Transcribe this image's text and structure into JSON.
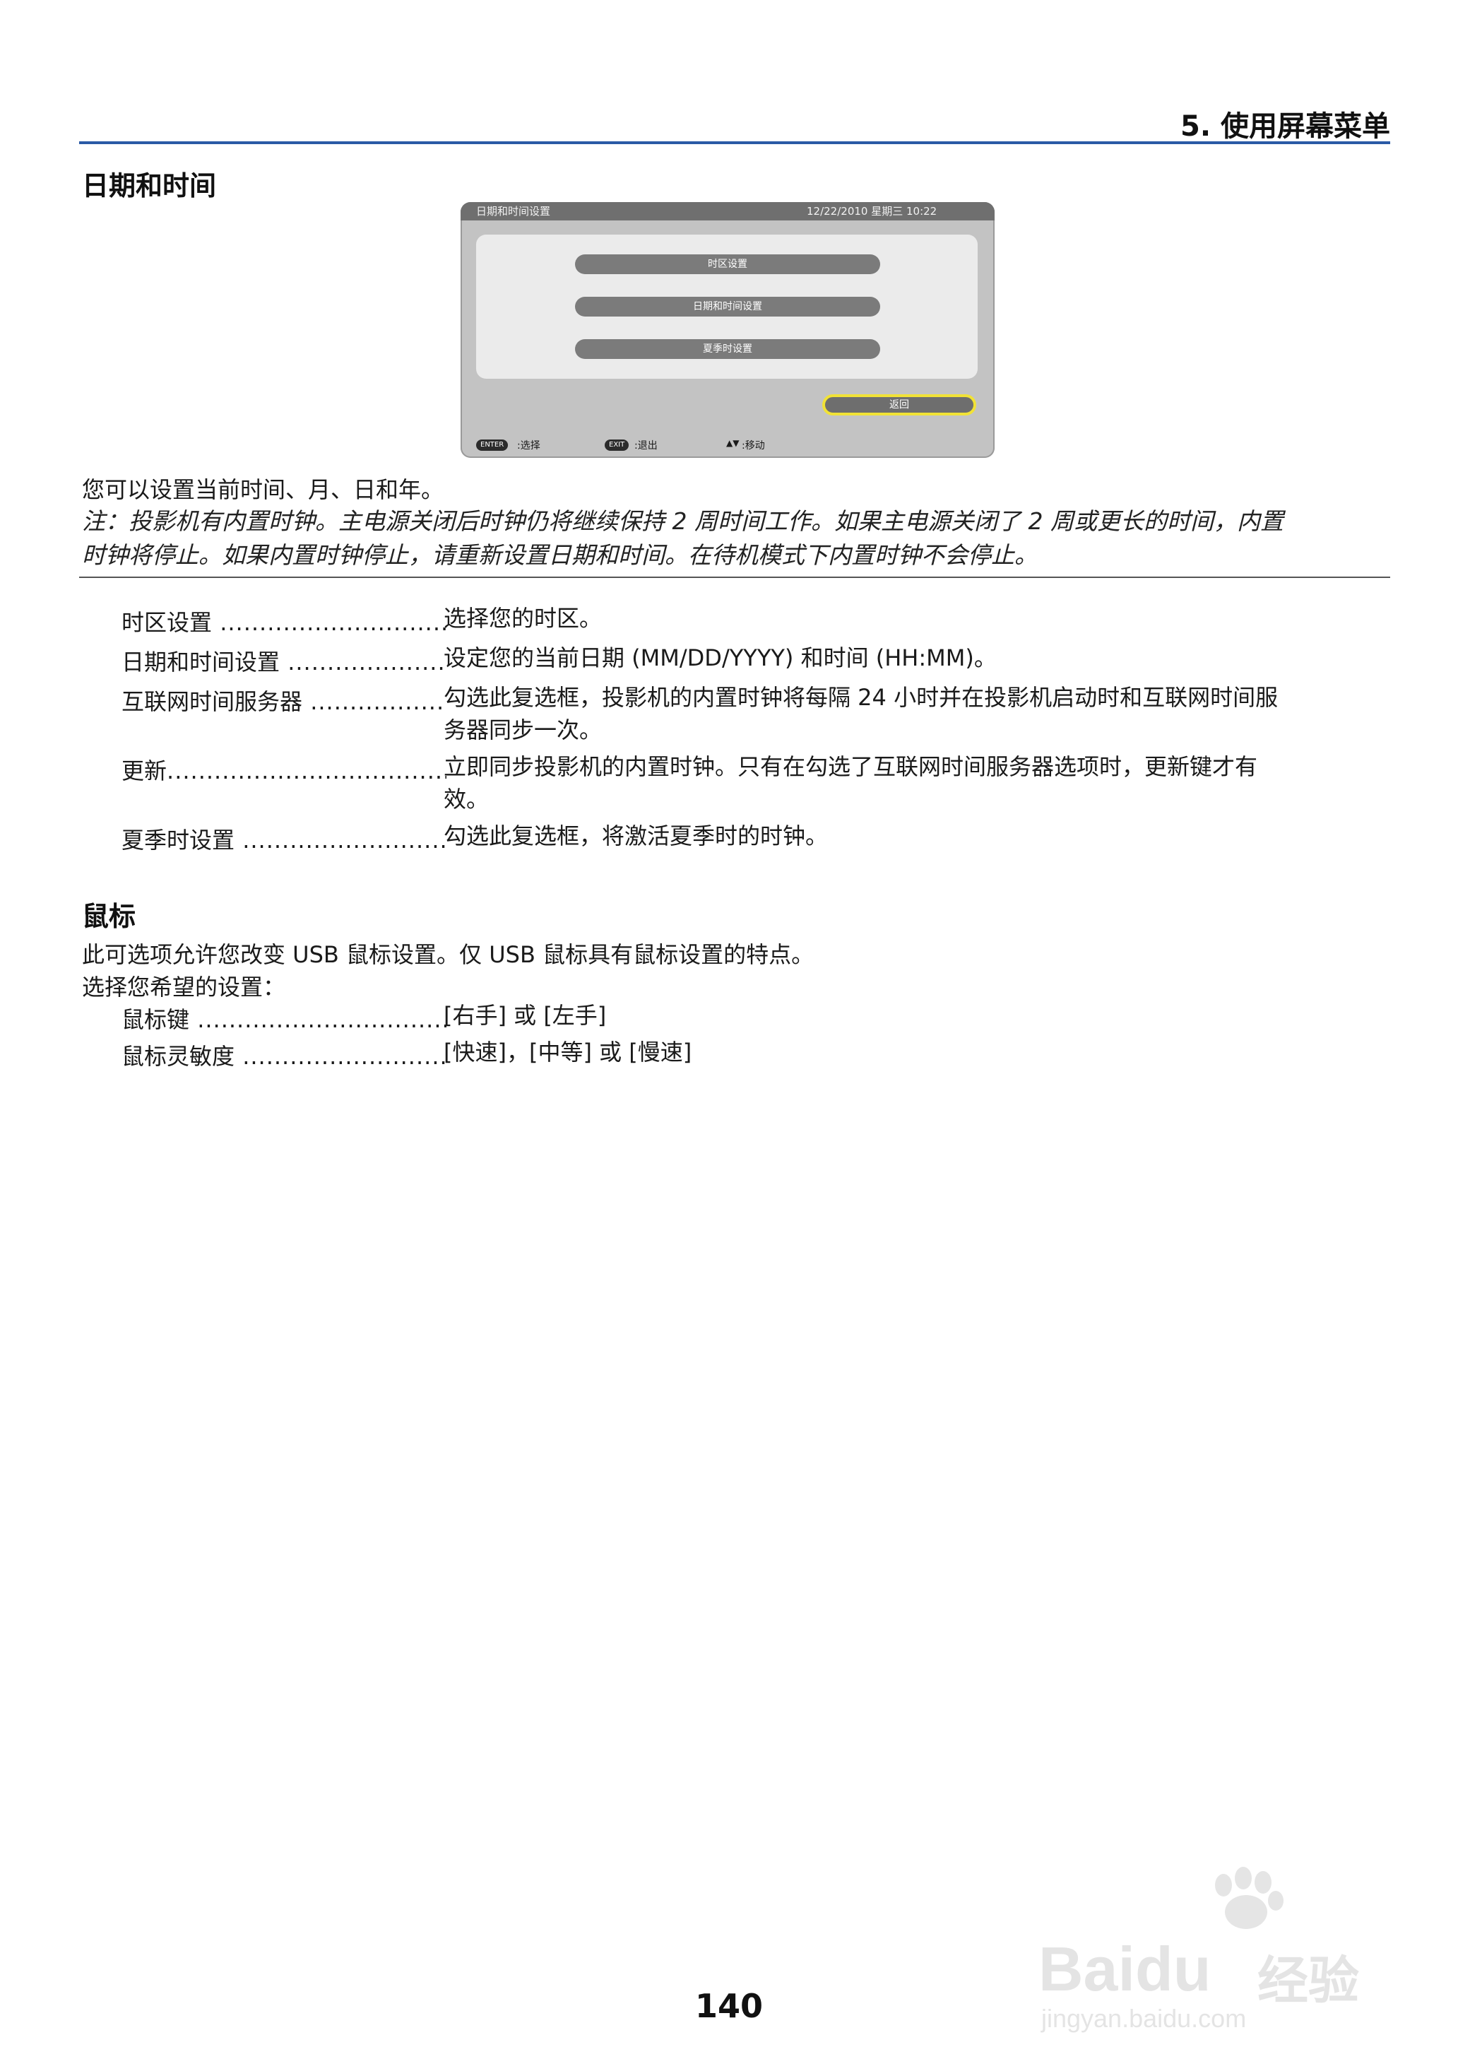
{
  "header": {
    "chapter": "5. 使用屏幕菜单"
  },
  "section1": {
    "title": "日期和时间"
  },
  "osd": {
    "title": "日期和时间设置",
    "datetime": "12/22/2010 星期三 10:22",
    "buttons": [
      "时区设置",
      "日期和时间设置",
      "夏季时设置"
    ],
    "back": "返回",
    "footer": {
      "enter_key": "ENTER",
      "enter_label": ":选择",
      "exit_key": "EXIT",
      "exit_label": ":退出",
      "move_label": ":移动"
    }
  },
  "intro": "您可以设置当前时间、月、日和年。",
  "note": {
    "line1": "注：投影机有内置时钟。主电源关闭后时钟仍将继续保持 2 周时间工作。如果主电源关闭了 2 周或更长的时间，内置",
    "line2": "时钟将停止。如果内置时钟停止，请重新设置日期和时间。在待机模式下内置时钟不会停止。"
  },
  "items": [
    {
      "term": "时区设置",
      "desc1": "选择您的时区。",
      "desc2": ""
    },
    {
      "term": "日期和时间设置",
      "desc1": "设定您的当前日期 (MM/DD/YYYY) 和时间 (HH:MM)。",
      "desc2": ""
    },
    {
      "term": "互联网时间服务器",
      "desc1": "勾选此复选框，投影机的内置时钟将每隔 24 小时并在投影机启动时和互联网时间服",
      "desc2": "务器同步一次。"
    },
    {
      "term": "更新",
      "desc1": "立即同步投影机的内置时钟。只有在勾选了互联网时间服务器选项时，更新键才有",
      "desc2": "效。"
    },
    {
      "term": "夏季时设置",
      "desc1": "勾选此复选框，将激活夏季时的时钟。",
      "desc2": ""
    }
  ],
  "section2": {
    "title": "鼠标",
    "line1": "此可选项允许您改变 USB 鼠标设置。仅 USB 鼠标具有鼠标设置的特点。",
    "line2": "选择您希望的设置："
  },
  "mouse_items": [
    {
      "term": "鼠标键",
      "desc": "[右手] 或 [左手]"
    },
    {
      "term": "鼠标灵敏度",
      "desc": "[快速]，[中等] 或 [慢速]"
    }
  ],
  "page_number": "140",
  "watermark": {
    "brand": "Bai",
    "brand2": "du",
    "cn": "经验",
    "url": "jingyan.baidu.com"
  }
}
